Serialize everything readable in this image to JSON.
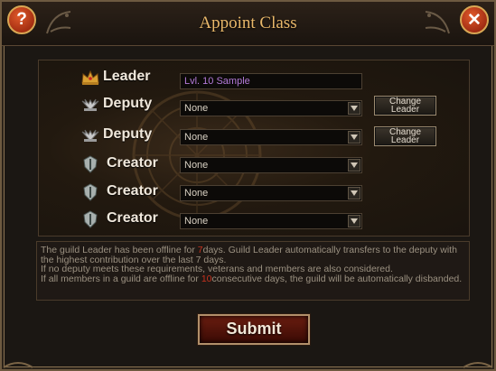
{
  "dialog": {
    "title": "Appoint Class",
    "help_symbol": "?",
    "close_symbol": "✕"
  },
  "rows": [
    {
      "role": "Leader",
      "icon": "crown-icon",
      "value": "Lvl. 10 Sample"
    },
    {
      "role": "Deputy",
      "icon": "wings-icon",
      "value": "None",
      "button": "Change Leader"
    },
    {
      "role": "Deputy",
      "icon": "wings-icon",
      "value": "None",
      "button": "Change Leader"
    },
    {
      "role": "Creator",
      "icon": "shield-icon",
      "value": "None"
    },
    {
      "role": "Creator",
      "icon": "shield-icon",
      "value": "None"
    },
    {
      "role": "Creator",
      "icon": "shield-icon",
      "value": "None"
    }
  ],
  "notice": {
    "p1": "The guild Leader has been offline for ",
    "n1": "7",
    "p2": "days. Guild Leader automatically transfers to the deputy  with the highest contribution over the last 7 days.",
    "line2": " If no deputy meets these requirements, veterans and members are also considered.",
    "p3": "If all members in a guild are offline for ",
    "n2": "10",
    "p4": "consecutive days, the guild will be automatically disbanded."
  },
  "submit_label": "Submit",
  "colors": {
    "title": "#e9b86a",
    "leader_name": "#b37ad9",
    "highlight": "#c8321e",
    "submit_bg": "#6a1d10"
  }
}
